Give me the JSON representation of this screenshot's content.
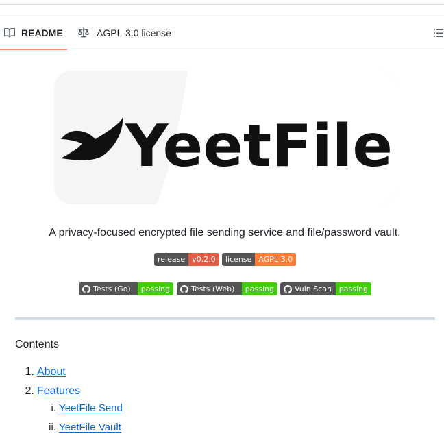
{
  "tabs": [
    {
      "label": "README",
      "icon": "book-icon",
      "active": true
    },
    {
      "label": "AGPL-3.0 license",
      "icon": "law-scale-icon",
      "active": false
    }
  ],
  "outline_icon": "list-unordered-icon",
  "banner": {
    "wordmark": "YeetFile"
  },
  "tagline": "A privacy-focused encrypted file sending service and file/password vault.",
  "badges_row1": [
    {
      "label": "release",
      "value": "v0.2.0",
      "color": "#e05d44"
    },
    {
      "label": "license",
      "value": "AGPL-3.0",
      "color": "#fe7d37"
    }
  ],
  "badges_row2": [
    {
      "label": "Tests (Go)",
      "value": "passing",
      "color": "#4c1"
    },
    {
      "label": "Tests (Web)",
      "value": "passing",
      "color": "#4c1"
    },
    {
      "label": "Vuln Scan",
      "value": "passing",
      "color": "#4c1"
    }
  ],
  "contents": {
    "heading": "Contents",
    "items": [
      {
        "num": "1.",
        "label": "About"
      },
      {
        "num": "2.",
        "label": "Features"
      }
    ],
    "subitems": [
      {
        "num": "i.",
        "label": "YeetFile Send"
      },
      {
        "num": "ii.",
        "label": "YeetFile Vault"
      }
    ]
  },
  "colors": {
    "link": "#0969da",
    "tab_underline": "#fd8c73",
    "border": "#d1d9e0"
  }
}
